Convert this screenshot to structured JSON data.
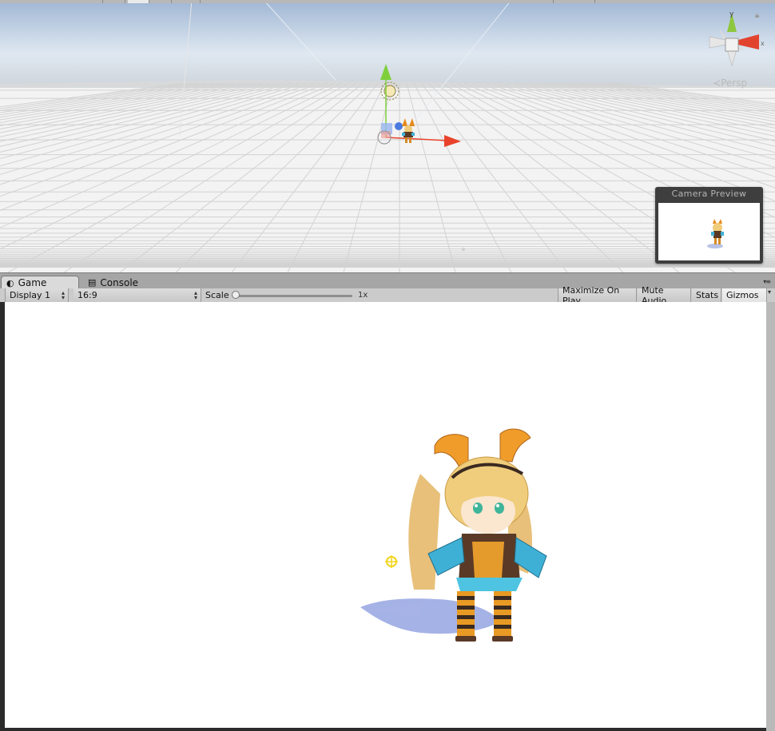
{
  "scene": {
    "persp_label": "Persp",
    "gizmo_axes": {
      "y": "y",
      "x": "x"
    },
    "camera_preview_title": "Camera Preview",
    "icons": {
      "lock": "lock-icon",
      "move_tool": "move-gizmo-icon",
      "light": "sun-light-icon"
    }
  },
  "tabs": [
    {
      "label": "Game",
      "icon": "game-controller-icon",
      "active": true
    },
    {
      "label": "Console",
      "icon": "console-icon",
      "active": false
    }
  ],
  "toolbar": {
    "display": "Display 1",
    "aspect": "16:9",
    "scale_label": "Scale",
    "scale_value": "1x",
    "scale_level": 0,
    "maximize_label": "Maximize On Play",
    "mute_label": "Mute Audio",
    "stats_label": "Stats",
    "gizmos_label": "Gizmos"
  },
  "colors": {
    "x_axis": "#e8432a",
    "y_axis": "#7fcf3a",
    "z_axis": "#4a7be0",
    "sky_top": "#9bb3d2",
    "grid_floor": "#f4f4f4",
    "game_background": "#ffffff",
    "editor_chrome": "#c2c2c2"
  }
}
